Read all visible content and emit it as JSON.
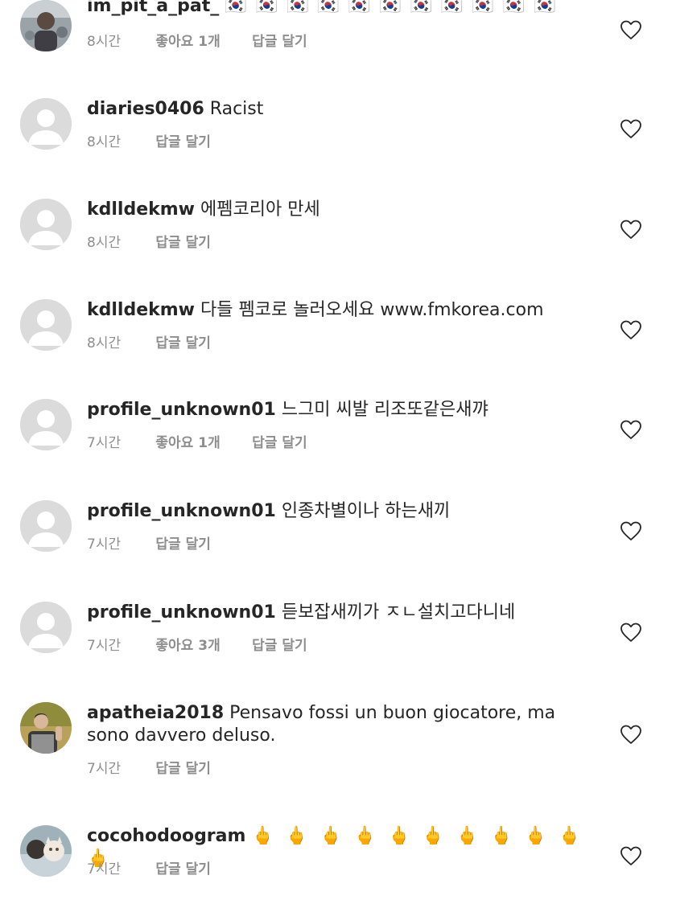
{
  "comments": [
    {
      "username": "im_pit_a_pat_",
      "text": "🇰🇷 🇰🇷 🇰🇷 🇰🇷 🇰🇷 🇰🇷 🇰🇷 🇰🇷 🇰🇷 🇰🇷 🇰🇷",
      "time": "8시간",
      "likes": "좋아요 1개",
      "reply": "답글 달기",
      "avatar": "photo-avatar"
    },
    {
      "username": "diaries0406",
      "text": "Racist",
      "time": "8시간",
      "likes": "",
      "reply": "답글 달기",
      "avatar": "default-avatar"
    },
    {
      "username": "kdlldekmw",
      "text": "에펨코리아 만세",
      "time": "8시간",
      "likes": "",
      "reply": "답글 달기",
      "avatar": "default-avatar"
    },
    {
      "username": "kdlldekmw",
      "text": "다들 펨코로 놀러오세요 www.fmkorea.com",
      "time": "8시간",
      "likes": "",
      "reply": "답글 달기",
      "avatar": "default-avatar"
    },
    {
      "username": "profile_unknown01",
      "text": "느그미 씨발 리조또같은새꺄",
      "time": "7시간",
      "likes": "좋아요 1개",
      "reply": "답글 달기",
      "avatar": "default-avatar"
    },
    {
      "username": "profile_unknown01",
      "text": "인종차별이나 하는새끼",
      "time": "7시간",
      "likes": "",
      "reply": "답글 달기",
      "avatar": "default-avatar"
    },
    {
      "username": "profile_unknown01",
      "text": "듣보잡새끼가 ㅈㄴ설치고다니네",
      "time": "7시간",
      "likes": "좋아요 3개",
      "reply": "답글 달기",
      "avatar": "default-avatar"
    },
    {
      "username": "apatheia2018",
      "text": "Pensavo fossi un buon giocatore, ma sono davvero deluso.",
      "time": "7시간",
      "likes": "",
      "reply": "답글 달기",
      "avatar": "photo-avatar"
    },
    {
      "username": "cocohodoogram",
      "text": "🖕 🖕 🖕 🖕 🖕 🖕 🖕 🖕 🖕 🖕 🖕",
      "time": "7시간",
      "likes": "",
      "reply": "답글 달기",
      "avatar": "photo-avatar"
    }
  ],
  "icons": {
    "like": "heart-outline-icon",
    "default_avatar": "default-profile-icon"
  },
  "colors": {
    "text": "#262626",
    "meta": "#8e8e8e",
    "avatar_placeholder": "#dbdbdb"
  }
}
